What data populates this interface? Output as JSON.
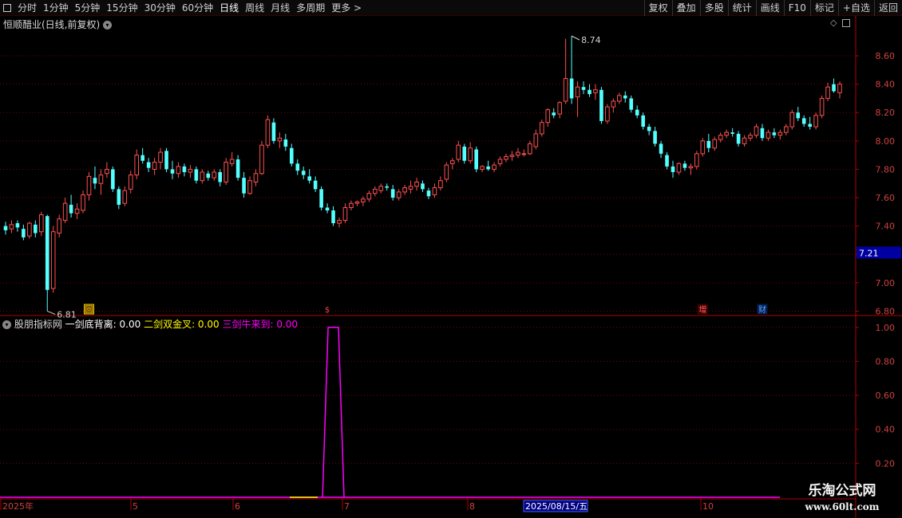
{
  "toolbar": {
    "periods": [
      "分时",
      "1分钟",
      "5分钟",
      "15分钟",
      "30分钟",
      "60分钟",
      "日线",
      "周线",
      "月线",
      "多周期",
      "更多 >"
    ],
    "active_period": "日线",
    "right_buttons": [
      "复权",
      "叠加",
      "多股",
      "统计",
      "画线",
      "F10",
      "标记",
      "+自选",
      "返回"
    ]
  },
  "main_panel": {
    "title": "恒顺醋业(日线,前复权)",
    "current_price_label": "7.21",
    "high_label": "8.74",
    "low_label": "6.81",
    "markers": [
      "回",
      "$",
      "增",
      "财"
    ]
  },
  "indicator_panel": {
    "name": "股朋指标网",
    "line1": "一剑底背离: 0.00",
    "line2": "二剑双金叉: 0.00",
    "line3": "三剑牛来到: 0.00"
  },
  "time_axis": {
    "labels": [
      "2025年",
      "5",
      "6",
      "7",
      "8",
      "2025/08/15/五",
      "10"
    ]
  },
  "watermark": {
    "line1": "乐淘公式网",
    "line2": "www.60lt.com"
  },
  "colors": {
    "up": "#ff5050",
    "down": "#54ffff",
    "grid": "#7a0000",
    "axis": "#b00000",
    "signal": "#ff00ff"
  },
  "chart_data": [
    {
      "type": "candlestick",
      "title": "恒顺醋业(日线,前复权)",
      "y_ticks": [
        6.8,
        7.0,
        7.2,
        7.4,
        7.6,
        7.8,
        8.0,
        8.2,
        8.4,
        8.6
      ],
      "ylim": [
        6.78,
        8.78
      ],
      "x_labels": [
        "2025年",
        "5",
        "6",
        "7",
        "8",
        "10"
      ],
      "grid": true,
      "ohlc": [
        [
          7.4,
          7.43,
          7.34,
          7.37
        ],
        [
          7.38,
          7.44,
          7.35,
          7.41
        ],
        [
          7.42,
          7.44,
          7.36,
          7.39
        ],
        [
          7.38,
          7.41,
          7.3,
          7.32
        ],
        [
          7.33,
          7.43,
          7.31,
          7.42
        ],
        [
          7.41,
          7.44,
          7.32,
          7.35
        ],
        [
          7.36,
          7.5,
          7.33,
          7.48
        ],
        [
          7.47,
          7.48,
          6.8,
          6.95
        ],
        [
          6.96,
          7.4,
          6.93,
          7.36
        ],
        [
          7.35,
          7.48,
          7.32,
          7.45
        ],
        [
          7.44,
          7.6,
          7.42,
          7.56
        ],
        [
          7.55,
          7.62,
          7.46,
          7.49
        ],
        [
          7.49,
          7.56,
          7.45,
          7.52
        ],
        [
          7.51,
          7.65,
          7.49,
          7.62
        ],
        [
          7.62,
          7.78,
          7.58,
          7.75
        ],
        [
          7.74,
          7.82,
          7.66,
          7.7
        ],
        [
          7.7,
          7.8,
          7.62,
          7.76
        ],
        [
          7.77,
          7.85,
          7.74,
          7.8
        ],
        [
          7.8,
          7.82,
          7.64,
          7.66
        ],
        [
          7.66,
          7.68,
          7.52,
          7.55
        ],
        [
          7.56,
          7.68,
          7.54,
          7.65
        ],
        [
          7.66,
          7.79,
          7.63,
          7.76
        ],
        [
          7.76,
          7.94,
          7.73,
          7.9
        ],
        [
          7.9,
          7.95,
          7.84,
          7.86
        ],
        [
          7.85,
          7.88,
          7.78,
          7.81
        ],
        [
          7.8,
          7.88,
          7.76,
          7.85
        ],
        [
          7.85,
          7.95,
          7.8,
          7.92
        ],
        [
          7.93,
          7.95,
          7.78,
          7.8
        ],
        [
          7.8,
          7.86,
          7.73,
          7.77
        ],
        [
          7.77,
          7.85,
          7.74,
          7.82
        ],
        [
          7.82,
          7.84,
          7.75,
          7.78
        ],
        [
          7.78,
          7.83,
          7.74,
          7.8
        ],
        [
          7.8,
          7.82,
          7.7,
          7.72
        ],
        [
          7.72,
          7.8,
          7.7,
          7.78
        ],
        [
          7.77,
          7.79,
          7.72,
          7.74
        ],
        [
          7.74,
          7.8,
          7.72,
          7.78
        ],
        [
          7.78,
          7.8,
          7.68,
          7.71
        ],
        [
          7.71,
          7.88,
          7.69,
          7.85
        ],
        [
          7.84,
          7.92,
          7.82,
          7.87
        ],
        [
          7.87,
          7.9,
          7.72,
          7.74
        ],
        [
          7.74,
          7.78,
          7.6,
          7.63
        ],
        [
          7.63,
          7.75,
          7.62,
          7.72
        ],
        [
          7.71,
          7.8,
          7.68,
          7.77
        ],
        [
          7.77,
          8.0,
          7.76,
          7.97
        ],
        [
          7.97,
          8.18,
          7.95,
          8.15
        ],
        [
          8.13,
          8.16,
          7.98,
          8.0
        ],
        [
          8.0,
          8.06,
          7.95,
          8.02
        ],
        [
          8.01,
          8.05,
          7.93,
          7.96
        ],
        [
          7.95,
          7.98,
          7.82,
          7.84
        ],
        [
          7.84,
          7.87,
          7.76,
          7.79
        ],
        [
          7.79,
          7.82,
          7.73,
          7.76
        ],
        [
          7.75,
          7.8,
          7.7,
          7.72
        ],
        [
          7.72,
          7.75,
          7.64,
          7.66
        ],
        [
          7.66,
          7.68,
          7.51,
          7.53
        ],
        [
          7.53,
          7.56,
          7.49,
          7.51
        ],
        [
          7.51,
          7.54,
          7.4,
          7.42
        ],
        [
          7.42,
          7.46,
          7.39,
          7.44
        ],
        [
          7.44,
          7.56,
          7.42,
          7.53
        ],
        [
          7.53,
          7.58,
          7.51,
          7.56
        ],
        [
          7.56,
          7.58,
          7.54,
          7.57
        ],
        [
          7.57,
          7.61,
          7.54,
          7.59
        ],
        [
          7.59,
          7.65,
          7.57,
          7.63
        ],
        [
          7.63,
          7.68,
          7.61,
          7.66
        ],
        [
          7.65,
          7.7,
          7.63,
          7.68
        ],
        [
          7.68,
          7.7,
          7.65,
          7.67
        ],
        [
          7.66,
          7.69,
          7.58,
          7.6
        ],
        [
          7.6,
          7.66,
          7.58,
          7.64
        ],
        [
          7.64,
          7.69,
          7.62,
          7.67
        ],
        [
          7.66,
          7.72,
          7.63,
          7.68
        ],
        [
          7.68,
          7.74,
          7.65,
          7.71
        ],
        [
          7.7,
          7.72,
          7.64,
          7.66
        ],
        [
          7.65,
          7.67,
          7.59,
          7.61
        ],
        [
          7.62,
          7.7,
          7.6,
          7.67
        ],
        [
          7.67,
          7.75,
          7.65,
          7.72
        ],
        [
          7.73,
          7.85,
          7.71,
          7.83
        ],
        [
          7.84,
          7.88,
          7.8,
          7.86
        ],
        [
          7.87,
          8.0,
          7.85,
          7.97
        ],
        [
          7.96,
          7.98,
          7.84,
          7.86
        ],
        [
          7.86,
          7.99,
          7.84,
          7.95
        ],
        [
          7.94,
          7.96,
          7.78,
          7.8
        ],
        [
          7.8,
          7.83,
          7.78,
          7.82
        ],
        [
          7.82,
          7.86,
          7.79,
          7.8
        ],
        [
          7.8,
          7.85,
          7.78,
          7.83
        ],
        [
          7.84,
          7.89,
          7.82,
          7.87
        ],
        [
          7.87,
          7.91,
          7.85,
          7.89
        ],
        [
          7.89,
          7.93,
          7.86,
          7.9
        ],
        [
          7.9,
          7.95,
          7.88,
          7.92
        ],
        [
          7.91,
          7.94,
          7.89,
          7.91
        ],
        [
          7.91,
          8.0,
          7.9,
          7.98
        ],
        [
          7.96,
          8.08,
          7.94,
          8.05
        ],
        [
          8.05,
          8.15,
          8.03,
          8.13
        ],
        [
          8.13,
          8.23,
          8.1,
          8.22
        ],
        [
          8.2,
          8.23,
          8.16,
          8.18
        ],
        [
          8.19,
          8.28,
          8.16,
          8.27
        ],
        [
          8.28,
          8.72,
          8.26,
          8.44
        ],
        [
          8.44,
          8.74,
          8.26,
          8.3
        ],
        [
          8.31,
          8.42,
          8.17,
          8.38
        ],
        [
          8.38,
          8.42,
          8.33,
          8.36
        ],
        [
          8.36,
          8.4,
          8.31,
          8.33
        ],
        [
          8.34,
          8.4,
          8.29,
          8.36
        ],
        [
          8.36,
          8.38,
          8.12,
          8.14
        ],
        [
          8.14,
          8.26,
          8.12,
          8.24
        ],
        [
          8.24,
          8.3,
          8.2,
          8.28
        ],
        [
          8.28,
          8.34,
          8.26,
          8.32
        ],
        [
          8.32,
          8.35,
          8.27,
          8.3
        ],
        [
          8.3,
          8.32,
          8.2,
          8.22
        ],
        [
          8.22,
          8.25,
          8.16,
          8.18
        ],
        [
          8.18,
          8.2,
          8.08,
          8.1
        ],
        [
          8.1,
          8.12,
          8.04,
          8.07
        ],
        [
          8.07,
          8.1,
          7.96,
          7.98
        ],
        [
          7.98,
          8.0,
          7.88,
          7.91
        ],
        [
          7.9,
          7.92,
          7.8,
          7.82
        ],
        [
          7.82,
          7.86,
          7.74,
          7.78
        ],
        [
          7.78,
          7.85,
          7.76,
          7.84
        ],
        [
          7.84,
          7.86,
          7.79,
          7.81
        ],
        [
          7.81,
          7.84,
          7.76,
          7.82
        ],
        [
          7.82,
          7.93,
          7.8,
          7.91
        ],
        [
          7.91,
          8.02,
          7.89,
          8.0
        ],
        [
          8.0,
          8.05,
          7.92,
          7.95
        ],
        [
          7.95,
          8.03,
          7.93,
          8.01
        ],
        [
          8.01,
          8.06,
          7.99,
          8.04
        ],
        [
          8.04,
          8.08,
          8.02,
          8.06
        ],
        [
          8.06,
          8.09,
          8.03,
          8.05
        ],
        [
          8.05,
          8.07,
          7.96,
          7.98
        ],
        [
          7.98,
          8.04,
          7.96,
          8.02
        ],
        [
          8.02,
          8.06,
          8.0,
          8.04
        ],
        [
          8.04,
          8.12,
          8.02,
          8.1
        ],
        [
          8.09,
          8.12,
          8.0,
          8.02
        ],
        [
          8.02,
          8.08,
          8.0,
          8.06
        ],
        [
          8.06,
          8.09,
          8.02,
          8.04
        ],
        [
          8.04,
          8.08,
          8.01,
          8.06
        ],
        [
          8.06,
          8.12,
          8.04,
          8.1
        ],
        [
          8.1,
          8.22,
          8.08,
          8.2
        ],
        [
          8.2,
          8.24,
          8.14,
          8.16
        ],
        [
          8.16,
          8.18,
          8.1,
          8.12
        ],
        [
          8.12,
          8.17,
          8.08,
          8.1
        ],
        [
          8.1,
          8.2,
          8.08,
          8.18
        ],
        [
          8.18,
          8.32,
          8.16,
          8.3
        ],
        [
          8.3,
          8.41,
          8.28,
          8.38
        ],
        [
          8.4,
          8.44,
          8.34,
          8.35
        ],
        [
          8.34,
          8.42,
          8.3,
          8.4
        ]
      ]
    },
    {
      "type": "line",
      "title": "股朋指标网",
      "y_ticks": [
        0.2,
        0.4,
        0.6,
        0.8,
        1.0
      ],
      "ylim": [
        0.0,
        1.06
      ],
      "grid": true,
      "series": [
        {
          "name": "一剑底背离",
          "values": [
            0.0
          ],
          "color": "#ffffff"
        },
        {
          "name": "二剑双金叉",
          "values": [
            0.0
          ],
          "color": "#ffff00"
        },
        {
          "name": "三剑牛来到",
          "color": "#ff00ff",
          "pulse": {
            "start_bar": 54,
            "end_bar": 56,
            "value": 1.0
          }
        }
      ]
    }
  ]
}
